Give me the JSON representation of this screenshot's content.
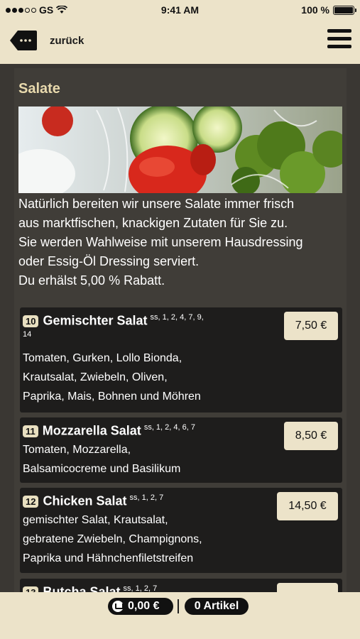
{
  "status_bar": {
    "carrier": "GS",
    "time": "9:41 AM",
    "battery": "100 %"
  },
  "nav": {
    "back_label": "zurück"
  },
  "section": {
    "title": "Salate",
    "intro_lines": [
      "Natürlich bereiten wir unsere Salate immer frisch",
      "aus marktfischen, knackigen Zutaten für Sie zu.",
      "Sie werden Wahlweise mit unserem Hausdressing",
      "oder Essig-Öl Dressing serviert.",
      "Du erhälst 5,00 % Rabatt."
    ]
  },
  "items": [
    {
      "number": "10",
      "name": "Gemischter Salat",
      "codes": "ss, 1, 2, 4, 7, 9,",
      "codes_cont": "14",
      "price": "7,50 €",
      "desc_lines": [
        "Tomaten, Gurken, Lollo Bionda,",
        "Krautsalat, Zwiebeln, Oliven,",
        "Paprika, Mais, Bohnen und Möhren"
      ]
    },
    {
      "number": "11",
      "name": "Mozzarella Salat",
      "codes": "ss, 1, 2, 4, 6, 7",
      "price": "8,50 €",
      "desc_lines": [
        "Tomaten, Mozzarella,",
        "Balsamicocreme und Basilikum"
      ]
    },
    {
      "number": "12",
      "name": "Chicken Salat",
      "codes": "ss, 1, 2, 7",
      "price": "14,50 €",
      "desc_lines": [
        "gemischter Salat, Krautsalat,",
        "gebratene Zwiebeln, Champignons,",
        "Paprika und Hähnchenfiletstreifen"
      ]
    },
    {
      "number": "13",
      "name": "Butcha Salat",
      "codes": "ss, 1, 2, 7"
    }
  ],
  "cart": {
    "total": "0,00 €",
    "articles": "0 Artikel"
  }
}
